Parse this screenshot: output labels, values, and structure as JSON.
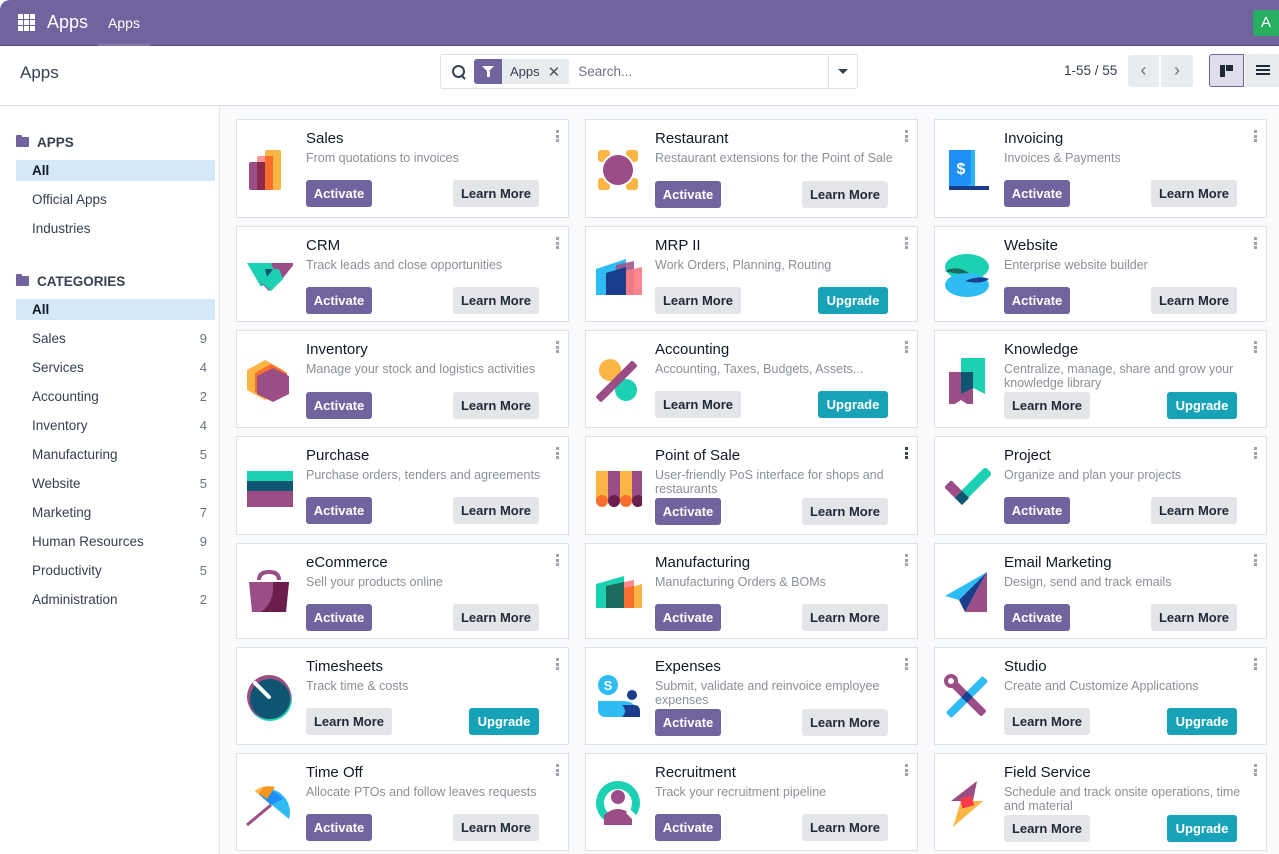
{
  "navbar": {
    "brand": "Apps",
    "menu_item": "Apps",
    "avatar_initial": "A",
    "accent_color": "#71639e",
    "avatar_color": "#27ae60"
  },
  "control_panel": {
    "title": "Apps",
    "search": {
      "facet_label": "Apps",
      "facet_icon": "filter-icon",
      "placeholder": "Search..."
    },
    "pager": "1-55 / 55",
    "pager_prev": "‹",
    "pager_next": "›"
  },
  "sidebar": {
    "apps_section": {
      "header": "APPS",
      "items": [
        {
          "label": "All",
          "active": true
        },
        {
          "label": "Official Apps"
        },
        {
          "label": "Industries"
        }
      ]
    },
    "categories_section": {
      "header": "CATEGORIES",
      "items": [
        {
          "label": "All",
          "active": true,
          "count": ""
        },
        {
          "label": "Sales",
          "count": "9"
        },
        {
          "label": "Services",
          "count": "4"
        },
        {
          "label": "Accounting",
          "count": "2"
        },
        {
          "label": "Inventory",
          "count": "4"
        },
        {
          "label": "Manufacturing",
          "count": "5"
        },
        {
          "label": "Website",
          "count": "5"
        },
        {
          "label": "Marketing",
          "count": "7"
        },
        {
          "label": "Human Resources",
          "count": "9"
        },
        {
          "label": "Productivity",
          "count": "5"
        },
        {
          "label": "Administration",
          "count": "2"
        }
      ]
    }
  },
  "buttons": {
    "activate": "Activate",
    "learn_more": "Learn More",
    "upgrade": "Upgrade"
  },
  "apps": [
    {
      "name": "Sales",
      "desc": "From quotations to invoices",
      "state": "activate",
      "icon": "sales-icon"
    },
    {
      "name": "Restaurant",
      "desc": "Restaurant extensions for the Point of Sale",
      "state": "activate",
      "icon": "restaurant-icon"
    },
    {
      "name": "Invoicing",
      "desc": "Invoices & Payments",
      "state": "activate",
      "icon": "invoicing-icon"
    },
    {
      "name": "CRM",
      "desc": "Track leads and close opportunities",
      "state": "activate",
      "icon": "crm-icon"
    },
    {
      "name": "MRP II",
      "desc": "Work Orders, Planning, Routing",
      "state": "upgrade",
      "icon": "mrp-icon"
    },
    {
      "name": "Website",
      "desc": "Enterprise website builder",
      "state": "activate",
      "icon": "website-icon"
    },
    {
      "name": "Inventory",
      "desc": "Manage your stock and logistics activities",
      "state": "activate",
      "icon": "inventory-icon"
    },
    {
      "name": "Accounting",
      "desc": "Accounting, Taxes, Budgets, Assets...",
      "state": "upgrade",
      "icon": "accounting-icon"
    },
    {
      "name": "Knowledge",
      "desc": "Centralize, manage, share and grow your knowledge library",
      "state": "upgrade",
      "icon": "knowledge-icon"
    },
    {
      "name": "Purchase",
      "desc": "Purchase orders, tenders and agreements",
      "state": "activate",
      "icon": "purchase-icon"
    },
    {
      "name": "Point of Sale",
      "desc": "User-friendly PoS interface for shops and restaurants",
      "state": "activate",
      "icon": "point-of-sale-icon"
    },
    {
      "name": "Project",
      "desc": "Organize and plan your projects",
      "state": "activate",
      "icon": "project-icon"
    },
    {
      "name": "eCommerce",
      "desc": "Sell your products online",
      "state": "activate",
      "icon": "ecommerce-icon"
    },
    {
      "name": "Manufacturing",
      "desc": "Manufacturing Orders & BOMs",
      "state": "activate",
      "icon": "manufacturing-icon"
    },
    {
      "name": "Email Marketing",
      "desc": "Design, send and track emails",
      "state": "activate",
      "icon": "email-marketing-icon"
    },
    {
      "name": "Timesheets",
      "desc": "Track time & costs",
      "state": "upgrade",
      "icon": "timesheets-icon"
    },
    {
      "name": "Expenses",
      "desc": "Submit, validate and reinvoice employee expenses",
      "state": "activate",
      "icon": "expenses-icon"
    },
    {
      "name": "Studio",
      "desc": "Create and Customize Applications",
      "state": "upgrade",
      "icon": "studio-icon"
    },
    {
      "name": "Time Off",
      "desc": "Allocate PTOs and follow leaves requests",
      "state": "activate",
      "icon": "time-off-icon"
    },
    {
      "name": "Recruitment",
      "desc": "Track your recruitment pipeline",
      "state": "activate",
      "icon": "recruitment-icon"
    },
    {
      "name": "Field Service",
      "desc": "Schedule and track onsite operations, time and material",
      "state": "upgrade",
      "icon": "field-service-icon"
    }
  ]
}
